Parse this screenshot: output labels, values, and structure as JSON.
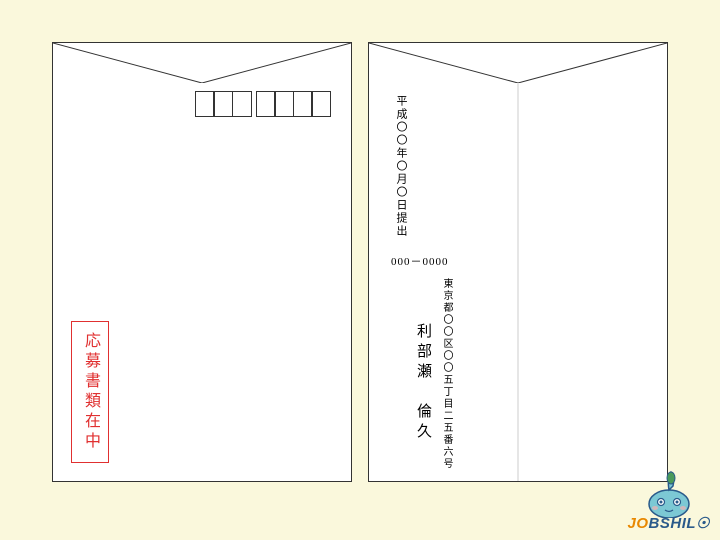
{
  "envelope_front": {
    "stamp_text": "応募書類在中"
  },
  "envelope_back": {
    "date": "平成〇〇年〇月〇日提出",
    "postal_code": "000－0000",
    "address": "東京都〇〇区〇〇五丁目二五番六号",
    "name": "利部瀬　倫久"
  },
  "logo": {
    "text_part1": "JO",
    "text_part2": "BSHIL☉"
  }
}
